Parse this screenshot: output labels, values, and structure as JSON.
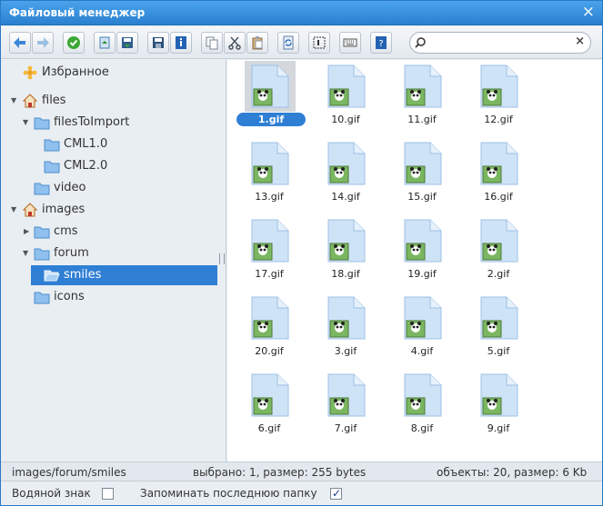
{
  "window": {
    "title": "Файловый менеджер",
    "close_glyph": "×"
  },
  "toolbar": {
    "buttons": [
      {
        "name": "back-button",
        "icon": "arrow-left-icon"
      },
      {
        "name": "forward-button",
        "icon": "arrow-right-icon"
      },
      {
        "name": "apply-button",
        "icon": "check-circle-icon"
      },
      {
        "name": "upload-button",
        "icon": "upload-icon"
      },
      {
        "name": "download-button",
        "icon": "download-icon"
      },
      {
        "name": "save-button",
        "icon": "floppy-icon"
      },
      {
        "name": "info-button",
        "icon": "info-icon"
      },
      {
        "name": "copy-button",
        "icon": "copy-icon"
      },
      {
        "name": "cut-button",
        "icon": "scissors-icon"
      },
      {
        "name": "paste-button",
        "icon": "paste-icon"
      },
      {
        "name": "refresh-button",
        "icon": "refresh-icon"
      },
      {
        "name": "select-button",
        "icon": "select-icon"
      },
      {
        "name": "view-button",
        "icon": "keyboard-icon"
      },
      {
        "name": "help-button",
        "icon": "help-icon"
      }
    ],
    "search": {
      "placeholder": "",
      "value": "",
      "clear_glyph": "×"
    }
  },
  "sidebar": {
    "favorites_label": "Избранное",
    "tree": [
      {
        "label": "files",
        "icon": "home-icon",
        "expanded": true
      },
      {
        "label": "filesToImport",
        "icon": "folder-icon",
        "expanded": true
      },
      {
        "label": "CML1.0",
        "icon": "folder-icon"
      },
      {
        "label": "CML2.0",
        "icon": "folder-icon"
      },
      {
        "label": "video",
        "icon": "folder-icon"
      },
      {
        "label": "images",
        "icon": "home-icon",
        "expanded": true
      },
      {
        "label": "cms",
        "icon": "folder-icon",
        "expanded": false
      },
      {
        "label": "forum",
        "icon": "folder-icon",
        "expanded": true
      },
      {
        "label": "smiles",
        "icon": "folder-open-icon",
        "selected": true
      },
      {
        "label": "icons",
        "icon": "folder-icon"
      }
    ]
  },
  "files": [
    "1.gif",
    "10.gif",
    "11.gif",
    "12.gif",
    "13.gif",
    "14.gif",
    "15.gif",
    "16.gif",
    "17.gif",
    "18.gif",
    "19.gif",
    "2.gif",
    "20.gif",
    "3.gif",
    "4.gif",
    "5.gif",
    "6.gif",
    "7.gif",
    "8.gif",
    "9.gif"
  ],
  "selected_file": "1.gif",
  "status": {
    "path": "images/forum/smiles",
    "selection": "выбрано: 1, размер: 255 bytes",
    "objects": "объекты: 20, размер: 6 Kb"
  },
  "footer": {
    "watermark_label": "Водяной знак",
    "watermark_checked": false,
    "remember_label": "Запоминать последнюю папку",
    "remember_checked": true
  },
  "colors": {
    "accent": "#2f7fd4",
    "titlebar": "#3a90dd"
  }
}
